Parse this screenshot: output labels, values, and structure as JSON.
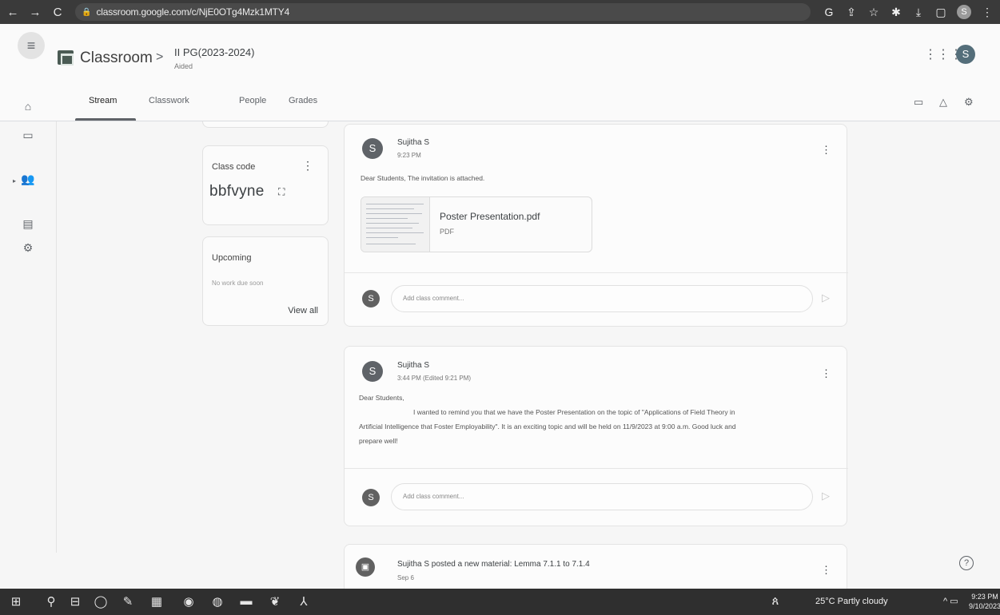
{
  "browser": {
    "back": "←",
    "forward": "→",
    "reload": "C",
    "lock": "🔒",
    "url": "classroom.google.com/c/NjE0OTg4Mzk1MTY4",
    "icons": [
      "G",
      "⇪",
      "☆",
      "✱",
      "⤓",
      "▢"
    ],
    "profile_letter": "S",
    "menu": "⋮"
  },
  "header": {
    "menu_icon": "≡",
    "app_name": "Classroom",
    "separator": ">",
    "class_name": "II PG(2023-2024)",
    "class_section": "Aided",
    "apps_icon": "⋮⋮⋮",
    "avatar_letter": "S"
  },
  "tabs": [
    {
      "label": "Stream"
    },
    {
      "label": "Classwork"
    },
    {
      "label": "People"
    },
    {
      "label": "Grades"
    }
  ],
  "tab_tools": {
    "calendar": "▭",
    "drive": "△",
    "settings": "⚙"
  },
  "rail": {
    "home": "⌂",
    "calendar": "▭",
    "people": "👥",
    "todo": "▤",
    "settings": "⚙",
    "caret": "▸"
  },
  "class_code": {
    "label": "Class code",
    "value": "bbfvyne",
    "menu": "⋮",
    "expand": "⛶"
  },
  "upcoming": {
    "title": "Upcoming",
    "empty": "No work due soon",
    "view_all": "View all"
  },
  "posts": [
    {
      "avatar": "S",
      "author": "Sujitha S",
      "time": "9:23 PM",
      "menu": "⋮",
      "body": "Dear Students,  The invitation is attached.",
      "attachment": {
        "name": "Poster Presentation.pdf",
        "type": "PDF"
      },
      "comment_avatar": "S",
      "comment_placeholder": "Add class comment...",
      "send": "▷"
    },
    {
      "avatar": "S",
      "author": "Sujitha S",
      "time": "3:44 PM (Edited 9:21 PM)",
      "menu": "⋮",
      "body_line1": "Dear Students,",
      "body_line2": "I wanted to remind you that we have the Poster Presentation on the topic of \"Applications of Field Theory in",
      "body_line3": "Artificial Intelligence that Foster Employability\". It is an exciting topic and will be held on 11/9/2023 at 9:00 a.m. Good luck and",
      "body_line4": "prepare well!",
      "comment_avatar": "S",
      "comment_placeholder": "Add class comment...",
      "send": "▷"
    },
    {
      "avatar": "▣",
      "author": "Sujitha S posted a new material: Lemma 7.1.1 to 7.1.4",
      "time": "Sep 6",
      "menu": "⋮"
    }
  ],
  "help": "?",
  "taskbar": {
    "icons": [
      "⊞",
      "⚲",
      "⊟",
      "◯",
      "✎",
      "▦",
      "◉",
      "◍",
      "▬",
      "❦",
      "⅄"
    ],
    "person": "ጰ",
    "weather": "25°C  Partly cloudy",
    "tray": "^ ▭",
    "time": "9:23 PM",
    "date": "9/10/2023"
  }
}
